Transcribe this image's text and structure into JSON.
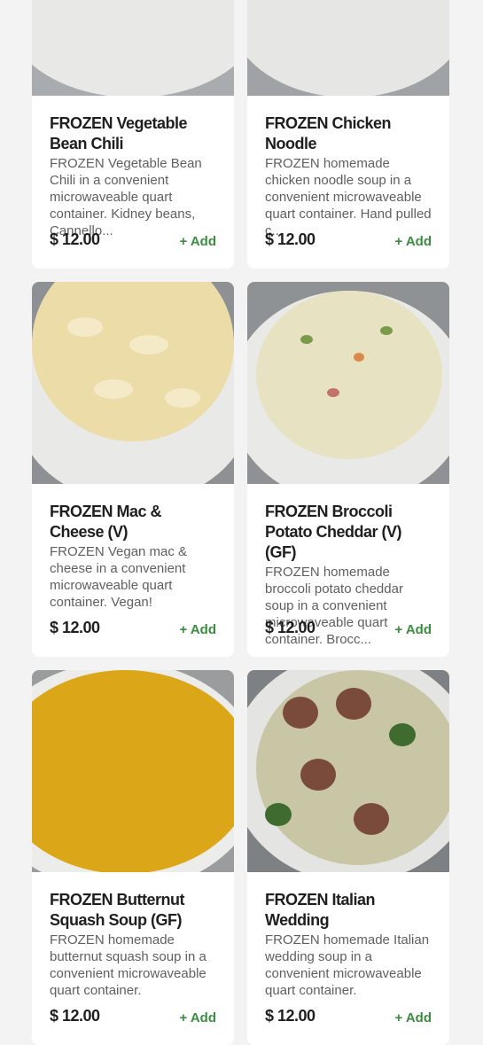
{
  "products": [
    {
      "name": "FROZEN Vegetable Bean Chili",
      "description": "FROZEN Vegetable Bean Chili in a convenient microwaveable quart container. Kidney beans, Cannello...",
      "price": "$ 12.00",
      "add_label": "+ Add"
    },
    {
      "name": "FROZEN Chicken Noodle",
      "description": "FROZEN homemade chicken noodle soup in a convenient microwaveable quart container. Hand pulled c...",
      "price": "$ 12.00",
      "add_label": "+ Add"
    },
    {
      "name": "FROZEN Mac & Cheese (V)",
      "description": "FROZEN Vegan mac & cheese in a convenient microwaveable quart container. Vegan!",
      "price": "$ 12.00",
      "add_label": "+ Add"
    },
    {
      "name": "FROZEN Broccoli Potato Cheddar (V)(GF)",
      "description": "FROZEN homemade broccoli potato cheddar soup in a convenient microwaveable quart container. Brocc...",
      "price": "$ 12.00",
      "add_label": "+ Add"
    },
    {
      "name": "FROZEN Butternut Squash Soup (GF)",
      "description": "FROZEN homemade butternut squash soup in a convenient microwaveable quart container.",
      "price": "$ 12.00",
      "add_label": "+ Add"
    },
    {
      "name": "FROZEN Italian Wedding",
      "description": "FROZEN homemade Italian wedding soup in a convenient microwaveable quart container.",
      "price": "$ 12.00",
      "add_label": "+ Add"
    }
  ],
  "colors": {
    "accent": "#3a8d3f",
    "card_bg": "#ffffff",
    "page_bg": "#f3f3f3"
  }
}
